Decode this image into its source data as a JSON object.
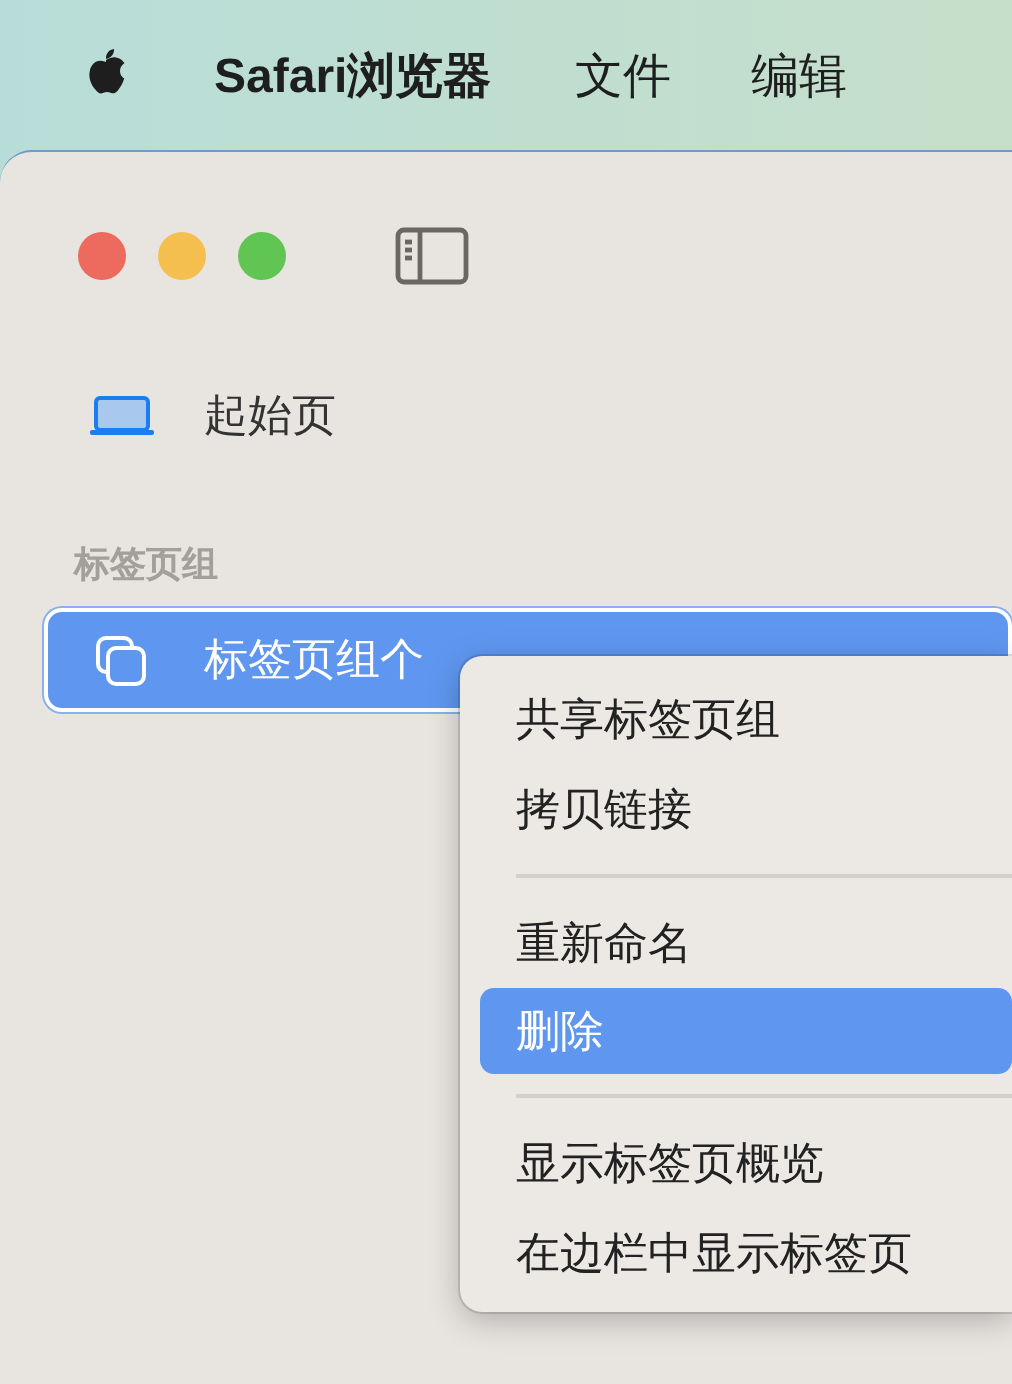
{
  "menu_bar": {
    "app_name": "Safari浏览器",
    "menus": [
      "文件",
      "编辑"
    ]
  },
  "window": {
    "traffic_lights": [
      {
        "color": "#ec6a5e"
      },
      {
        "color": "#f4bf4f"
      },
      {
        "color": "#61c554"
      }
    ],
    "sidebar": {
      "items": [
        {
          "label": "起始页",
          "kind": "start",
          "selected": false
        }
      ],
      "section_header": "标签页组",
      "tab_groups": [
        {
          "label": "标签页组个",
          "selected": true
        }
      ]
    }
  },
  "context_menu": {
    "groups": [
      [
        {
          "label": "共享标签页组",
          "selected": false
        },
        {
          "label": "拷贝链接",
          "selected": false
        }
      ],
      [
        {
          "label": "重新命名",
          "selected": false
        },
        {
          "label": "删除",
          "selected": true
        }
      ],
      [
        {
          "label": "显示标签页概览",
          "selected": false
        },
        {
          "label": "在边栏中显示标签页",
          "selected": false
        }
      ]
    ]
  }
}
